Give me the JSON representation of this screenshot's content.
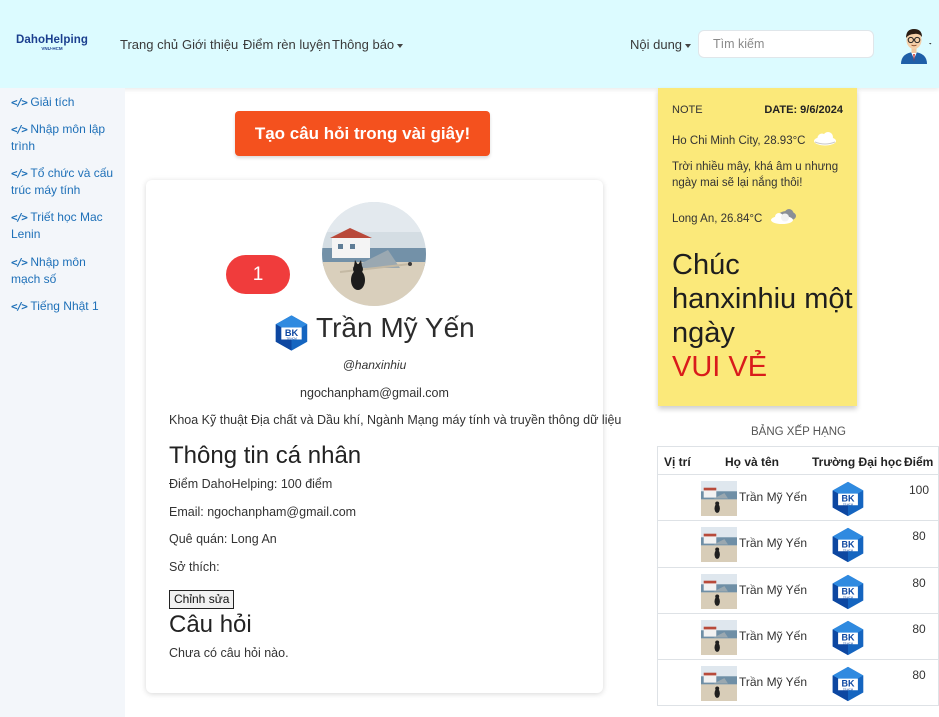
{
  "header": {
    "logo": "DahoHelping",
    "logo_sub": "VNU-HCM",
    "nav": {
      "home": "Trang chủ",
      "about": "Giới thiệu",
      "score": "Điểm rèn luyện",
      "notify": "Thông báo",
      "content": "Nội dung"
    },
    "search_placeholder": "Tìm kiếm"
  },
  "sidebar": {
    "items": [
      "Giải tích",
      "Nhập môn lập trình",
      "Tổ chức và cấu trúc máy tính",
      "Triết học Mac Lenin",
      "Nhập môn mạch số",
      "Tiếng Nhật 1"
    ]
  },
  "main": {
    "cta_label": "Tạo câu hỏi trong vài giây!",
    "badge": "1",
    "profile": {
      "name": "Trần Mỹ Yến",
      "username": "@hanxinhiu",
      "email": "ngochanpham@gmail.com",
      "faculty": "Khoa Kỹ thuật Địa chất và Dầu khí, Ngành Mạng máy tính và truyền thông dữ liệu"
    },
    "info_title": "Thông tin cá nhân",
    "info": {
      "points": "Điểm DahoHelping: 100 điểm",
      "email": "Email: ngochanpham@gmail.com",
      "hometown": "Quê quán: Long An",
      "hobbies": "Sở thích:"
    },
    "edit_label": "Chỉnh sửa",
    "questions_title": "Câu hỏi",
    "questions_empty": "Chưa có câu hỏi nào."
  },
  "note": {
    "label": "NOTE",
    "date": "DATE: 9/6/2024",
    "weather1": "Ho Chi Minh City, 28.93°C",
    "message": "Trời nhiều mây, khá âm u nhưng ngày mai sẽ lại nắng thôi!",
    "weather2": "Long An, 26.84°C",
    "greeting": "Chúc hanxinhiu một ngày",
    "greeting_highlight": "VUI VẺ"
  },
  "ranking": {
    "title": "BẢNG XẾP HẠNG",
    "headers": {
      "pos": "Vị trí",
      "name": "Họ và tên",
      "school": "Trường Đại học",
      "score": "Điểm"
    },
    "rows": [
      {
        "name": "Trần Mỹ Yến",
        "score": "100"
      },
      {
        "name": "Trần Mỹ Yến",
        "score": "80"
      },
      {
        "name": "Trần Mỹ Yến",
        "score": "80"
      },
      {
        "name": "Trần Mỹ Yến",
        "score": "80"
      },
      {
        "name": "Trần Mỹ Yến",
        "score": "80"
      }
    ]
  },
  "colors": {
    "navbar": "#dcfbff",
    "sidebar": "#f3f6fa",
    "link": "#1e70b8",
    "cta": "#f4511e",
    "badge": "#f03c3c",
    "note": "#fbe97a",
    "highlight": "#d91b1b"
  }
}
